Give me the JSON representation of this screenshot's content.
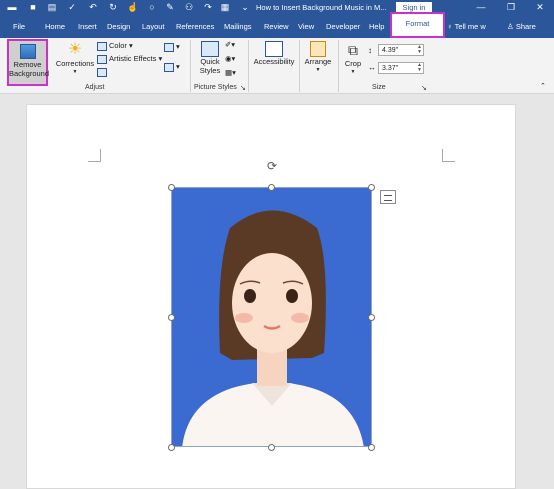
{
  "window": {
    "title": "How to Insert Background Music in M...",
    "sign_in": "Sign in",
    "minimize": "—",
    "restore": "❐",
    "close": "✕"
  },
  "tabs": {
    "file": "File",
    "home": "Home",
    "insert": "Insert",
    "design": "Design",
    "layout": "Layout",
    "references": "References",
    "mailings": "Mailings",
    "review": "Review",
    "view": "View",
    "developer": "Developer",
    "help": "Help",
    "format": "Format",
    "tell_me": "Tell me w",
    "share": "Share"
  },
  "ribbon": {
    "remove_background": "Remove Background",
    "corrections": "Corrections",
    "color": "Color",
    "artistic_effects": "Artistic Effects",
    "adjust_group": "Adjust",
    "quick_styles": "Quick Styles",
    "picture_styles_group": "Picture Styles",
    "accessibility": "Accessibility",
    "arrange": "Arrange",
    "crop": "Crop",
    "height_value": "4.39\"",
    "width_value": "3.37\"",
    "size_group": "Size"
  },
  "colors": {
    "word_blue": "#2b579a",
    "highlight": "#c832c8",
    "image_background": "#3b6ad0"
  }
}
